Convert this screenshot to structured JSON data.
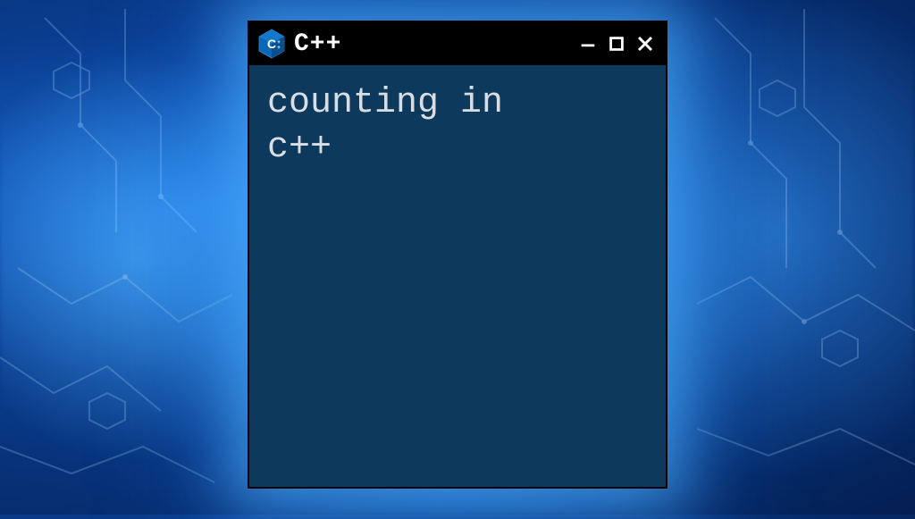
{
  "window": {
    "title": "C++",
    "icon_name": "cpp-logo-icon"
  },
  "content": {
    "line1": "counting in",
    "line2": "c++"
  },
  "colors": {
    "window_bg": "#0d3a5c",
    "titlebar_bg": "#000000",
    "text": "#d8dee3",
    "accent": "#0a66b7"
  }
}
